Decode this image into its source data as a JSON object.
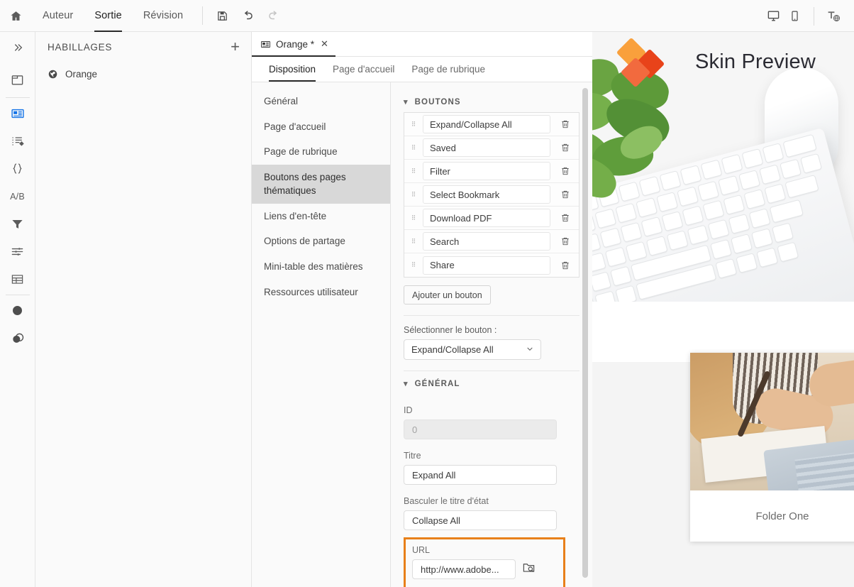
{
  "topbar": {
    "home_icon": "home-icon",
    "menu": [
      {
        "label": "Auteur",
        "active": false
      },
      {
        "label": "Sortie",
        "active": true
      },
      {
        "label": "Révision",
        "active": false
      }
    ],
    "tools": [
      {
        "icon": "save-icon",
        "name": "save-button"
      },
      {
        "icon": "undo-icon",
        "name": "undo-button"
      },
      {
        "icon": "redo-icon",
        "name": "redo-button"
      }
    ],
    "right_tools": [
      {
        "icon": "desktop-icon",
        "name": "desktop-preview-button"
      },
      {
        "icon": "mobile-icon",
        "name": "mobile-preview-button"
      },
      {
        "icon": "translate-icon",
        "name": "translate-button"
      }
    ]
  },
  "rail": {
    "items": [
      {
        "icon": "chevron-double-right-icon",
        "name": "expand-rail-button",
        "active": false
      },
      {
        "icon": "window-icon",
        "name": "rail-item-window",
        "active": false
      },
      {
        "icon": "skin-icon",
        "name": "rail-item-skins",
        "active": true
      },
      {
        "icon": "list-tag-icon",
        "name": "rail-item-attributes",
        "active": false
      },
      {
        "icon": "braces-icon",
        "name": "rail-item-variables",
        "active": false
      },
      {
        "icon": "ab-icon",
        "label": "A/B",
        "name": "rail-item-conditions",
        "active": false
      },
      {
        "icon": "funnel-icon",
        "name": "rail-item-filters",
        "active": false
      },
      {
        "icon": "sliders-icon",
        "name": "rail-item-settings",
        "active": false
      },
      {
        "icon": "table-icon",
        "name": "rail-item-table",
        "active": false
      },
      {
        "icon": "circle-icon",
        "name": "rail-item-styles",
        "active": false
      },
      {
        "icon": "layers-icon",
        "name": "rail-item-layers",
        "active": false
      }
    ]
  },
  "skins_panel": {
    "title": "HABILLAGES",
    "add_label": "+",
    "items": [
      {
        "label": "Orange",
        "icon": "globe-icon"
      }
    ]
  },
  "editor": {
    "doc_tab": {
      "label": "Orange *",
      "icon": "skin-icon",
      "close": "✕"
    },
    "subtabs": [
      {
        "label": "Disposition",
        "active": true
      },
      {
        "label": "Page d'accueil",
        "active": false
      },
      {
        "label": "Page de rubrique",
        "active": false
      }
    ],
    "nav": [
      {
        "label": "Général",
        "active": false
      },
      {
        "label": "Page d'accueil",
        "active": false
      },
      {
        "label": "Page de rubrique",
        "active": false
      },
      {
        "label": "Boutons des pages thématiques",
        "active": true
      },
      {
        "label": "Liens d'en-tête",
        "active": false
      },
      {
        "label": "Options de partage",
        "active": false
      },
      {
        "label": "Mini-table des matières",
        "active": false
      },
      {
        "label": "Ressources utilisateur",
        "active": false
      }
    ]
  },
  "properties": {
    "buttons_section": {
      "title": "BOUTONS",
      "rows": [
        {
          "label": "Expand/Collapse All"
        },
        {
          "label": "Saved"
        },
        {
          "label": "Filter"
        },
        {
          "label": "Select Bookmark"
        },
        {
          "label": "Download PDF"
        },
        {
          "label": "Search"
        },
        {
          "label": "Share"
        }
      ],
      "add_button_label": "Ajouter un bouton"
    },
    "select_button": {
      "label": "Sélectionner le bouton :",
      "value": "Expand/Collapse All"
    },
    "general_section": {
      "title": "GÉNÉRAL",
      "id": {
        "label": "ID",
        "value": "0",
        "disabled": true
      },
      "title_field": {
        "label": "Titre",
        "value": "Expand All"
      },
      "toggle_title_field": {
        "label": "Basculer le titre d'état",
        "value": "Collapse All"
      },
      "url_field": {
        "label": "URL",
        "value": "http://www.adobe...",
        "browse_icon": "folder-search-icon",
        "highlight_color": "#e8801a"
      }
    }
  },
  "preview": {
    "hero_title": "Skin Preview",
    "card": {
      "caption": "Folder One"
    }
  },
  "colors": {
    "accent_blue": "#1473e6",
    "highlight_orange": "#e8801a",
    "panel_bg": "#fafafa",
    "selected_nav": "#d8d8d8"
  }
}
